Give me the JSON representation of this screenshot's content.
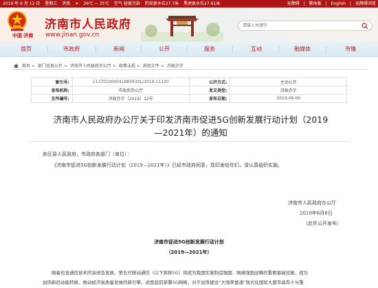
{
  "topbar": {
    "date": "2019 年 6 月 12 日",
    "weekday": "星期三",
    "city": "济南",
    "temp": "26℃ ~ 35℃",
    "air": "空气 轻度污染",
    "spring1": "趵突泉水位27.7米",
    "spring2": "黑虎泉水位27.61米",
    "links": [
      "无障碍",
      "繁体版",
      "English",
      "无障碍浏览"
    ]
  },
  "header": {
    "site_name": "济南市人民政府",
    "site_url": "www.jinan.gov.cn",
    "city_logo": "中国·济南",
    "search_placeholder": "请输入关键字"
  },
  "nav": {
    "items": [
      "首页",
      "市政府",
      "新闻",
      "公开",
      "服务",
      "互动",
      "融媒体",
      "市情"
    ]
  },
  "breadcrumb": [
    "首页",
    "部门信息公开",
    "济南市人民政府办公厅",
    "政策法规",
    "其他文件",
    "济政办字"
  ],
  "meta": {
    "rows": [
      {
        "l1": "索引号:",
        "v1": "11370100004188593XL/2019-11130",
        "l2": "公开方式:",
        "v2": "主动公开"
      },
      {
        "l1": "发布机构:",
        "v1": "市政府办公厅",
        "l2": "发文类型:",
        "v2": "济政办字"
      },
      {
        "l1": "文件编号:",
        "v1": "济政办字〔2019〕32号",
        "l2": "发布日期:",
        "v2": "2019-06-06"
      }
    ]
  },
  "article": {
    "title_line1": "济南市人民政府办公厅关于印发济南市促进5G创新发展行动计划（2019",
    "title_line2": "—2021年）的通知",
    "addressee": "各区县人民政府，市政府各部门（单位）：",
    "body": "《济南市促进5G创新发展行动计划（2019—2021年）》已经市政府同意，现印发给你们，请认真组织实施。",
    "signer": "济南市人民政府办公厅",
    "sign_date": "2019年6月6日",
    "sign_note": "（此件公开发布）",
    "sub_title": "济南市促进5G创新发展行动计划",
    "sub_period": "（2019—2021年）",
    "para_line1": "随着信息通信技术的演进及发展，第五代移动通信（以下简称5G）将成为我国实施制造强国、网络强国战略的重要基础设施，成为",
    "para_line2": "加快新旧动能转换、推动经济高质量发展的新引擎。适度超前部署5G网络，对于加快建设“大强美富通”现代化国际大都市具有十分重"
  },
  "colors": {
    "brand_red": "#c21818",
    "topbar": "#b01515",
    "nav_bg": "#e8f2f8"
  }
}
